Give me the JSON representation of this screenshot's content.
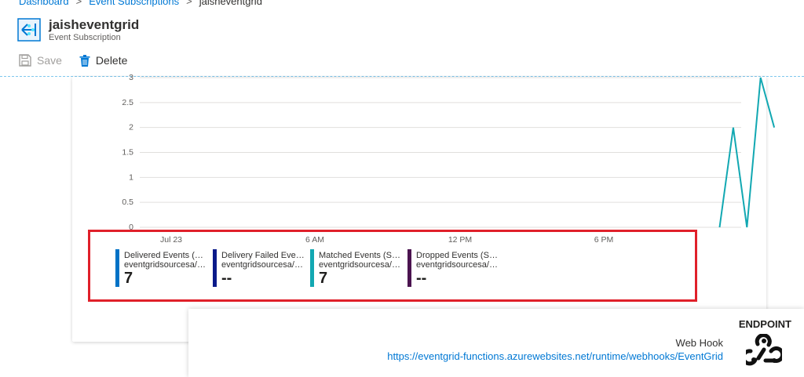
{
  "breadcrumb": {
    "items": [
      "Dashboard",
      "Event Subscriptions",
      "jaisheventgrid"
    ]
  },
  "header": {
    "title": "jaisheventgrid",
    "subtitle": "Event Subscription",
    "icon": "event-subscription-icon"
  },
  "toolbar": {
    "save_label": "Save",
    "delete_label": "Delete"
  },
  "chart_data": {
    "type": "line",
    "y_ticks": [
      "0",
      "0.5",
      "1",
      "1.5",
      "2",
      "2.5",
      "3"
    ],
    "x_ticks": [
      "Jul 23",
      "6 AM",
      "12 PM",
      "6 PM"
    ],
    "ylim": [
      0,
      3
    ],
    "grid": true,
    "series": [
      {
        "name": "Matched Events (Sum)",
        "color": "#12a8b2",
        "points": [
          [
            0.895,
            0
          ],
          [
            0.912,
            2
          ],
          [
            0.929,
            0
          ],
          [
            0.946,
            3
          ],
          [
            0.963,
            2
          ]
        ]
      }
    ],
    "legend": [
      {
        "name": "Delivered Events (Sum)",
        "resource": "eventgridsourcesa/mi...",
        "value": "7",
        "color": "#0072c6"
      },
      {
        "name": "Delivery Failed Even...",
        "resource": "eventgridsourcesa/mi...",
        "value": "--",
        "color": "#0a1a8a"
      },
      {
        "name": "Matched Events (Sum)",
        "resource": "eventgridsourcesa/mi...",
        "value": "7",
        "color": "#12a8b2"
      },
      {
        "name": "Dropped Events (Sum)",
        "resource": "eventgridsourcesa/mi...",
        "value": "--",
        "color": "#4b1450"
      }
    ]
  },
  "endpoint": {
    "title": "ENDPOINT",
    "type": "Web Hook",
    "url": "https://eventgrid-functions.azurewebsites.net/runtime/webhooks/EventGrid",
    "icon": "webhook-icon"
  }
}
